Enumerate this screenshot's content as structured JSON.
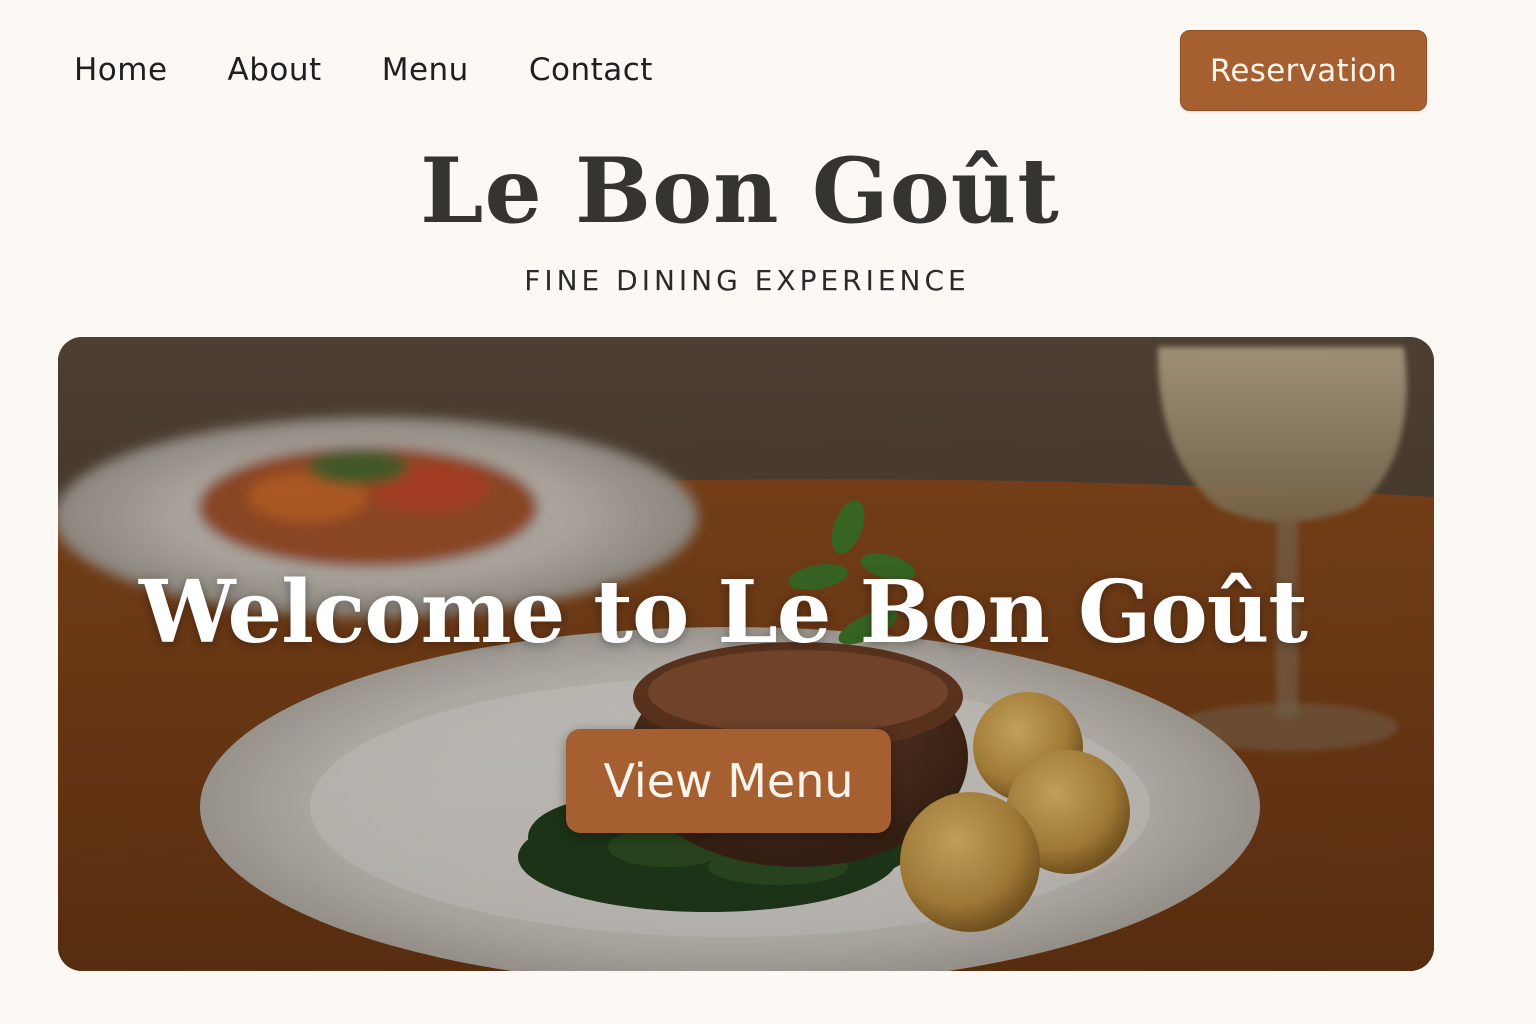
{
  "nav": {
    "items": [
      {
        "label": "Home"
      },
      {
        "label": "About"
      },
      {
        "label": "Menu"
      },
      {
        "label": "Contact"
      }
    ],
    "reservation_label": "Reservation"
  },
  "brand": {
    "name": "Le Bon Goût",
    "tagline": "FINE DINING EXPERIENCE"
  },
  "hero": {
    "title": "Welcome to Le Bon Goût",
    "cta_label": "View Menu"
  },
  "colors": {
    "background": "#fcf9f4",
    "accent": "#a55f30",
    "text_dark": "#353430"
  }
}
